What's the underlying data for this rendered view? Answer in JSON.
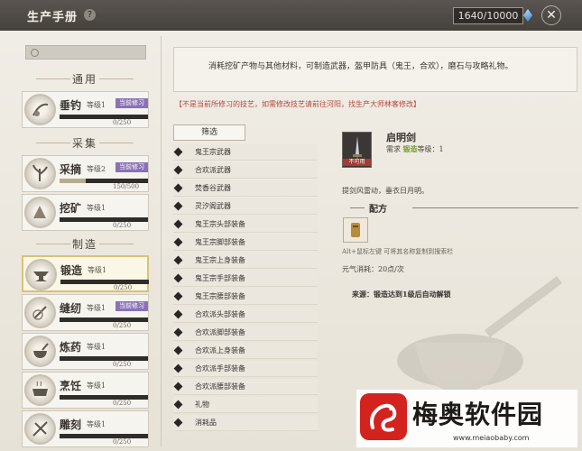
{
  "window": {
    "title": "生产手册",
    "help_icon": "?",
    "energy": "1640/10000",
    "close_icon": "✕"
  },
  "search": {
    "placeholder": ""
  },
  "categories": {
    "fishing": "通用",
    "gathering": "采集",
    "crafting": "制造"
  },
  "skills": [
    {
      "name": "垂钓",
      "level": "等级1",
      "tag": "当前修习",
      "value": "0/250",
      "progress": 0.0
    },
    {
      "name": "采摘",
      "level": "等级2",
      "tag": "当前修习",
      "value": "150/500",
      "progress": 0.3
    },
    {
      "name": "挖矿",
      "level": "等级1",
      "tag": "",
      "value": "0/250",
      "progress": 0.0
    },
    {
      "name": "锻造",
      "level": "等级1",
      "tag": "",
      "value": "0/250",
      "progress": 0.0
    },
    {
      "name": "缝纫",
      "level": "等级1",
      "tag": "当前修习",
      "value": "0/250",
      "progress": 0.0
    },
    {
      "name": "炼药",
      "level": "等级1",
      "tag": "",
      "value": "0/250",
      "progress": 0.0
    },
    {
      "name": "烹饪",
      "level": "等级1",
      "tag": "",
      "value": "0/250",
      "progress": 0.0
    },
    {
      "name": "雕刻",
      "level": "等级1",
      "tag": "",
      "value": "0/250",
      "progress": 0.0
    }
  ],
  "description": "消耗挖矿产物与其他材料，可制造武器，盔甲防具（鬼王，合欢），磨石与攻略礼物。",
  "warning": "【不是当前所修习的技艺，如需修改技艺请前往河阳，找生产大师林客修改】",
  "filter_label": "筛选",
  "list": [
    "鬼王宗武器",
    "合欢派武器",
    "焚香谷武器",
    "灵汐阁武器",
    "鬼王宗头部装备",
    "鬼王宗脚部装备",
    "鬼王宗上身装备",
    "鬼王宗手部装备",
    "鬼王宗腰部装备",
    "合欢派头部装备",
    "合欢派脚部装备",
    "合欢派上身装备",
    "合欢派手部装备",
    "合欢派腰部装备",
    "礼物",
    "消耗品"
  ],
  "detail": {
    "tag": "不可用",
    "name": "启明剑",
    "req_prefix": "需求",
    "req_skill": "锻造",
    "req_suffix": "等级：1",
    "description": "提剑风雷动，垂衣日月明。",
    "recipe_header": "配方",
    "hint": "Alt+鼠标左键 可将其名称复制到搜索栏",
    "cost": "元气消耗：20点/次",
    "source": "来源：锻造达到1级后自动解锁"
  },
  "watermark": {
    "title": "梅奥软件园",
    "url": "www.meiaobaby.com"
  }
}
